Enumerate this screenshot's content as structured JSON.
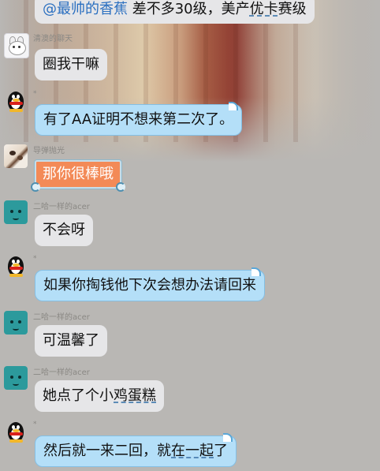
{
  "messages": [
    {
      "mention": "@最帅的香蕉",
      "text": "差不多30级，美产",
      "tail_a": "优卡",
      "tail_b": "赛级"
    },
    {
      "sender": "清澳的聊天",
      "text": "圈我干嘛"
    },
    {
      "mark": "*",
      "text": "有了AA证明不想来第二次了。"
    },
    {
      "sender": "导弹抛光",
      "text": "那你很棒哦"
    },
    {
      "sender": "二哈一样的acer",
      "text": "不会呀"
    },
    {
      "mark": "*",
      "text": "如果你掏钱他下次会想办法请回来"
    },
    {
      "sender": "二哈一样的acer",
      "text": "可温馨了"
    },
    {
      "sender": "二哈一样的acer",
      "text_a": "她点了个小",
      "text_b": "鸡蛋糕"
    },
    {
      "mark": "*",
      "text_a": "然后就一来二回，就",
      "text_b": "在一起",
      "text_c": "了"
    }
  ],
  "avatars": {
    "cat": "cat-icon",
    "qq": "penguin-icon",
    "dog": "dog-face-icon",
    "photo": "photo-avatar"
  },
  "colors": {
    "background": "#b9b7b4",
    "bubble_blue": "#b4dff8",
    "bubble_grey": "#e6e6e8",
    "bubble_orange": "#f38a57",
    "mention": "#2a6fc0"
  }
}
